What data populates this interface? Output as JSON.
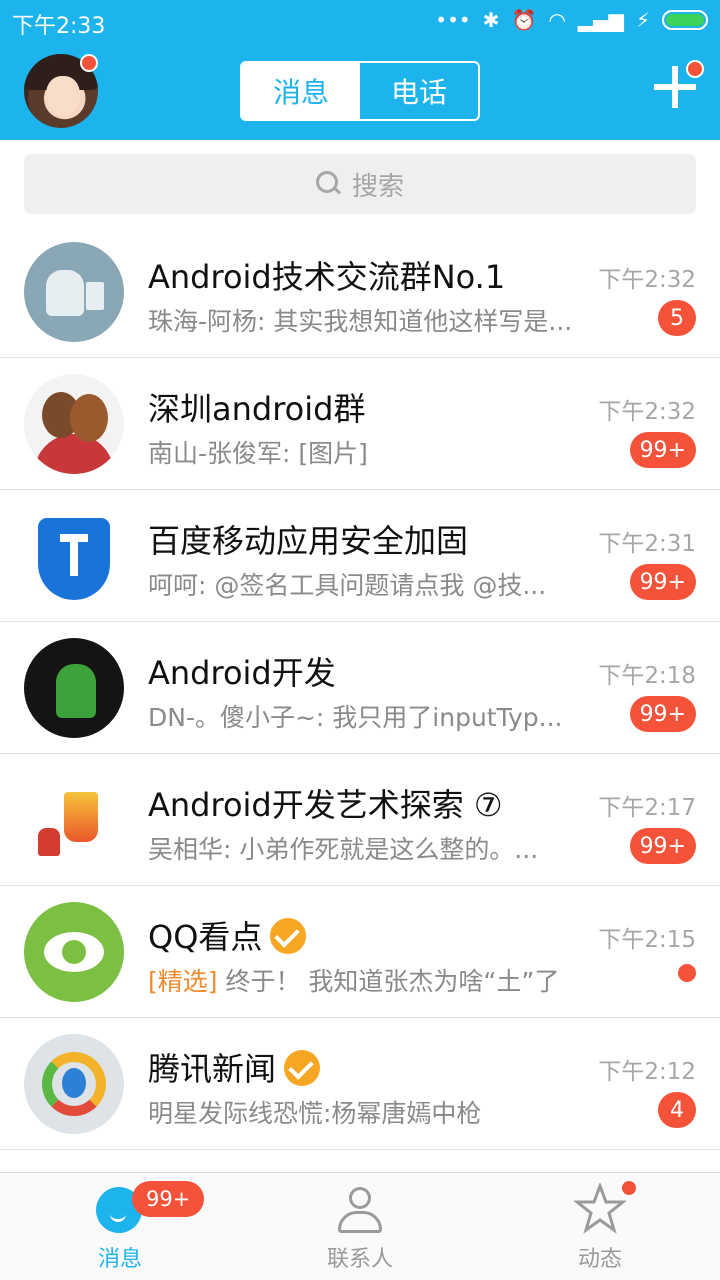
{
  "status_bar": {
    "time": "下午2:33",
    "icons": [
      "more-dots-icon",
      "bluetooth-icon",
      "alarm-icon",
      "wifi-icon",
      "signal-icon",
      "charging-icon",
      "battery-icon"
    ]
  },
  "header": {
    "tabs": [
      "消息",
      "电话"
    ],
    "active_tab": "消息"
  },
  "search": {
    "placeholder": "搜索"
  },
  "conversations": [
    {
      "title": "Android技术交流群No.1",
      "preview": "珠海-阿杨: 其实我想知道他这样写是...",
      "time": "下午2:32",
      "badge": "5"
    },
    {
      "title": "深圳android群",
      "preview": "南山-张俊军: [图片]",
      "time": "下午2:32",
      "badge": "99+"
    },
    {
      "title": "百度移动应用安全加固",
      "preview": "呵呵: @签名工具问题请点我 @技...",
      "time": "下午2:31",
      "badge": "99+"
    },
    {
      "title": "Android开发",
      "preview": "DN-。傻小子~: 我只用了inputTyp...",
      "time": "下午2:18",
      "badge": "99+"
    },
    {
      "title": "Android开发艺术探索 ⑦",
      "preview": "吴相华: 小弟作死就是这么整的。...",
      "time": "下午2:17",
      "badge": "99+"
    },
    {
      "title": "QQ看点",
      "preview_tag": "[精选]",
      "preview": "终于！ 我知道张杰为啥“土”了",
      "time": "下午2:15",
      "badge": ""
    },
    {
      "title": "腾讯新闻",
      "preview": "明星发际线恐慌:杨幂唐嫣中枪",
      "time": "下午2:12",
      "badge": "4"
    }
  ],
  "bottom_nav": {
    "messages": {
      "label": "消息",
      "badge": "99+"
    },
    "contacts": {
      "label": "联系人"
    },
    "moments": {
      "label": "动态"
    }
  },
  "colors": {
    "brand": "#1DB4EE",
    "badge": "#F5523A",
    "verified": "#F6A623",
    "tag": "#F08C2E"
  }
}
